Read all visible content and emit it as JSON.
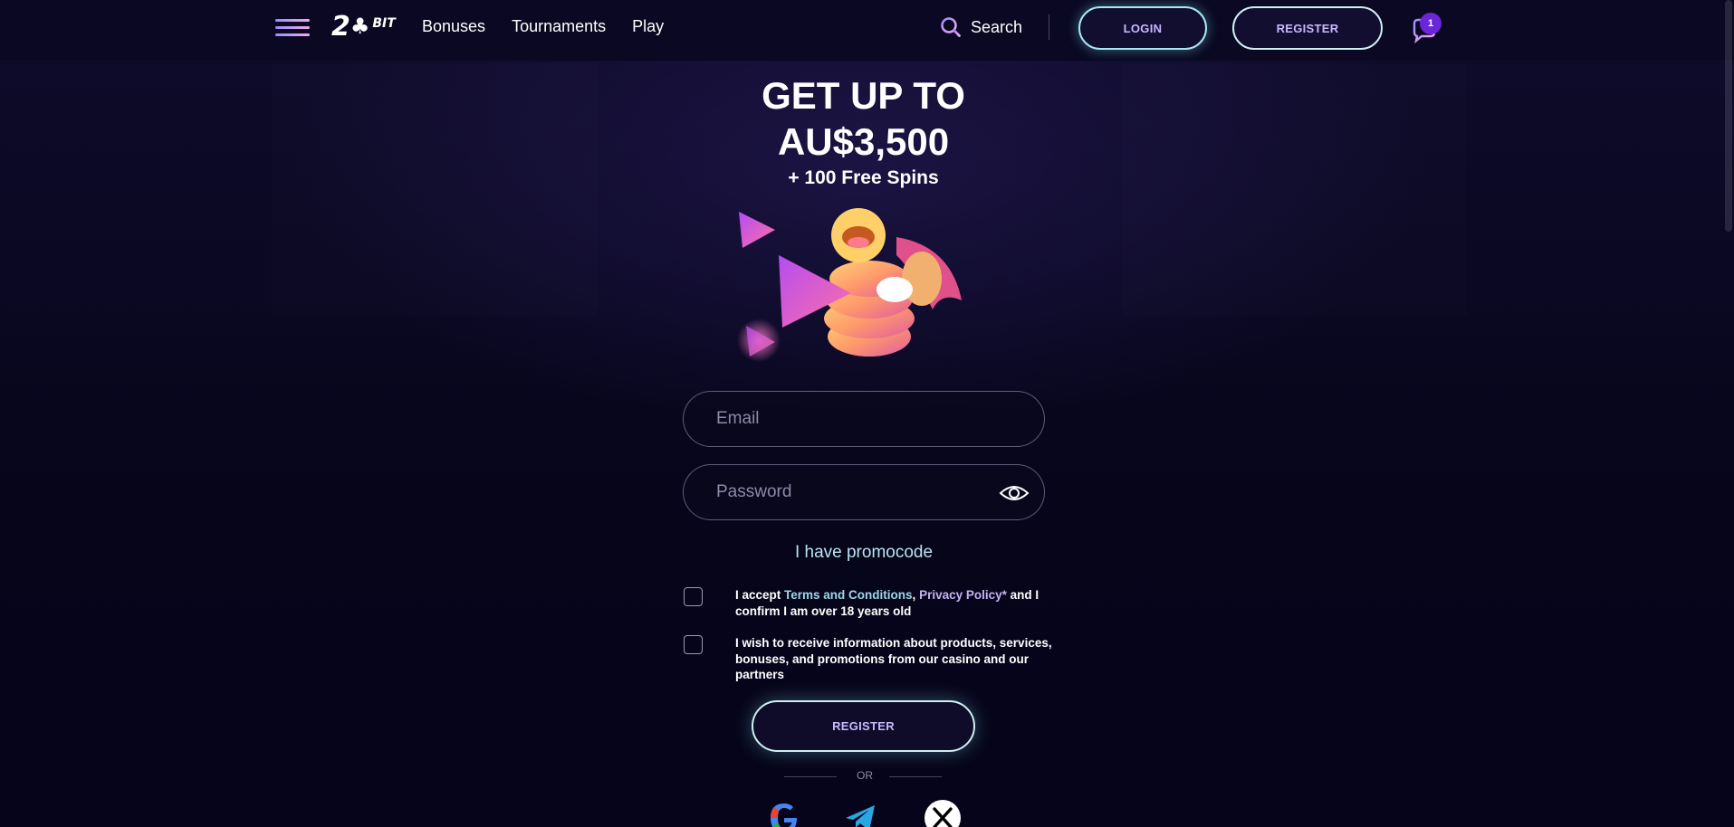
{
  "header": {
    "logo_main": "2",
    "logo_tree": "♣",
    "logo_sub": "BIT",
    "nav": [
      "Bonuses",
      "Tournaments",
      "Play"
    ],
    "search_label": "Search",
    "login_label": "LOGIN",
    "register_label": "REGISTER",
    "notification_count": "1"
  },
  "hero": {
    "line1": "GET UP TO",
    "line2": "AU$3,500",
    "line3": "+ 100 Free Spins"
  },
  "form": {
    "email_placeholder": "Email",
    "password_placeholder": "Password",
    "promo_label": "I have promocode",
    "consent1": {
      "prefix": "I accept ",
      "terms": "Terms and Conditions",
      "comma": ", ",
      "privacy": "Privacy Policy*",
      "suffix": " and I confirm I am over 18 years old"
    },
    "consent2": "I wish to receive information about products, services, bonuses, and promotions from our casino and our partners",
    "register_label": "REGISTER",
    "or_label": "OR"
  },
  "colors": {
    "background": "#07051a",
    "accent_cyan": "#a8e6f0",
    "accent_purple": "#c8b8ff",
    "badge": "#6b26d8"
  },
  "icons": [
    "menu-icon",
    "search-icon",
    "notification-icon",
    "eye-icon",
    "google-icon",
    "telegram-icon",
    "x-icon"
  ]
}
